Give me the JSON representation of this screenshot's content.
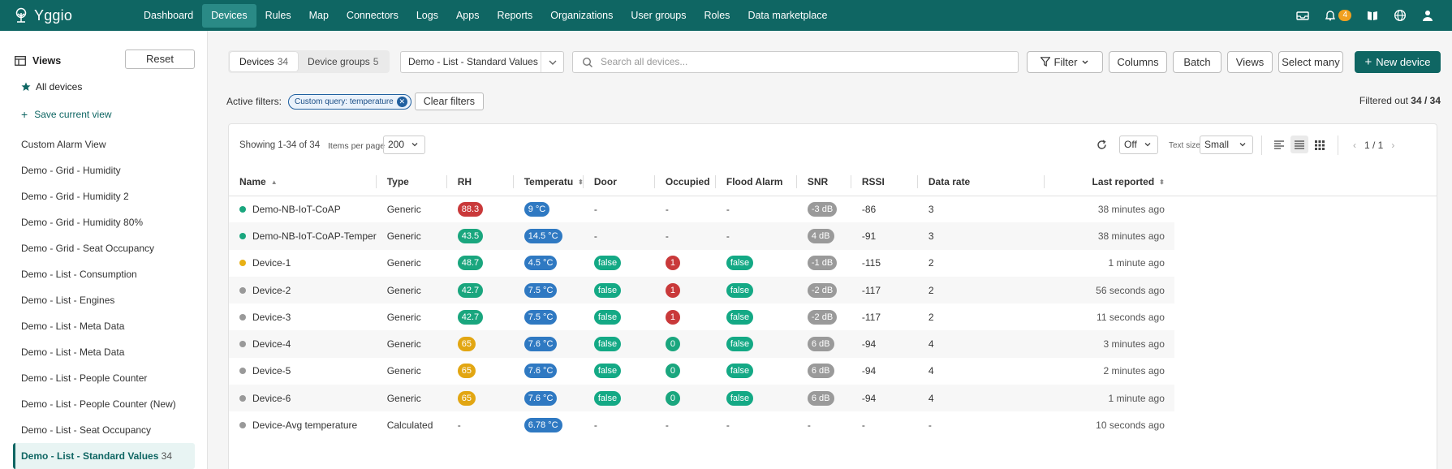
{
  "app": {
    "name": "Yggio",
    "notification_count": "4"
  },
  "nav": [
    "Dashboard",
    "Devices",
    "Rules",
    "Map",
    "Connectors",
    "Logs",
    "Apps",
    "Reports",
    "Organizations",
    "User groups",
    "Roles",
    "Data marketplace"
  ],
  "nav_active": "Devices",
  "sidebar": {
    "title": "Views",
    "reset_label": "Reset",
    "all_devices": "All devices",
    "save_view": "Save current view",
    "views": [
      {
        "label": "Custom Alarm View"
      },
      {
        "label": "Demo - Grid - Humidity"
      },
      {
        "label": "Demo - Grid - Humidity 2"
      },
      {
        "label": "Demo - Grid - Humidity 80%"
      },
      {
        "label": "Demo - Grid - Seat Occupancy"
      },
      {
        "label": "Demo - List - Consumption"
      },
      {
        "label": "Demo - List - Engines"
      },
      {
        "label": "Demo - List - Meta Data"
      },
      {
        "label": "Demo - List - Meta Data"
      },
      {
        "label": "Demo - List - People Counter"
      },
      {
        "label": "Demo - List - People Counter (New)"
      },
      {
        "label": "Demo - List - Seat Occupancy"
      },
      {
        "label": "Demo - List - Standard Values",
        "count": "34",
        "active": true
      }
    ]
  },
  "toolbar": {
    "tab_devices": "Devices",
    "tab_devices_count": "34",
    "tab_groups": "Device groups",
    "tab_groups_count": "5",
    "view_select": "Demo - List - Standard Values",
    "search_placeholder": "Search all devices...",
    "filter": "Filter",
    "columns": "Columns",
    "batch": "Batch",
    "views": "Views",
    "select_many": "Select many",
    "new_device": "New device"
  },
  "filters": {
    "label": "Active filters:",
    "chip": "Custom query: temperature",
    "clear": "Clear filters",
    "filtered_label": "Filtered out",
    "filtered_value": "34 / 34"
  },
  "table_controls": {
    "showing": "Showing 1-34 of 34",
    "items_per_page_label": "Items per page",
    "items_per_page": "200",
    "refresh": "Off",
    "text_size_label": "Text size",
    "text_size": "Small",
    "page": "1 / 1"
  },
  "columns": [
    "Name",
    "Type",
    "RH",
    "Temperatu",
    "Door",
    "Occupied",
    "Flood Alarm",
    "SNR",
    "RSSI",
    "Data rate",
    "Last reported"
  ],
  "colors": {
    "brand": "#0f6663",
    "green": "#1aa67e",
    "teal_pill": "#14a985",
    "red": "#c9393a",
    "blue": "#2f79c2",
    "yellow": "#e2a612",
    "gray": "#9a9a9a",
    "dot_gray": "#999999",
    "dot_green": "#1aa67e",
    "dot_yellow": "#e8b015"
  },
  "rows": [
    {
      "status": "green",
      "name": "Demo-NB-IoT-CoAP",
      "type": "Generic",
      "rh": "88.3",
      "rh_color": "red",
      "temp": "9 °C",
      "door": "-",
      "occupied": "-",
      "occupied_color": "",
      "flood": "-",
      "snr": "-3 dB",
      "rssi": "-86",
      "rate": "3",
      "last": "38 minutes ago"
    },
    {
      "status": "green",
      "name": "Demo-NB-IoT-CoAP-Temper",
      "type": "Generic",
      "rh": "43.5",
      "rh_color": "green",
      "temp": "14.5 °C",
      "door": "-",
      "occupied": "-",
      "occupied_color": "",
      "flood": "-",
      "snr": "4 dB",
      "rssi": "-91",
      "rate": "3",
      "last": "38 minutes ago"
    },
    {
      "status": "yellow",
      "name": "Device-1",
      "type": "Generic",
      "rh": "48.7",
      "rh_color": "green",
      "temp": "4.5 °C",
      "door": "false",
      "occupied": "1",
      "occupied_color": "red",
      "flood": "false",
      "snr": "-1 dB",
      "rssi": "-115",
      "rate": "2",
      "last": "1 minute ago"
    },
    {
      "status": "gray",
      "name": "Device-2",
      "type": "Generic",
      "rh": "42.7",
      "rh_color": "green",
      "temp": "7.5 °C",
      "door": "false",
      "occupied": "1",
      "occupied_color": "red",
      "flood": "false",
      "snr": "-2 dB",
      "rssi": "-117",
      "rate": "2",
      "last": "56 seconds ago"
    },
    {
      "status": "gray",
      "name": "Device-3",
      "type": "Generic",
      "rh": "42.7",
      "rh_color": "green",
      "temp": "7.5 °C",
      "door": "false",
      "occupied": "1",
      "occupied_color": "red",
      "flood": "false",
      "snr": "-2 dB",
      "rssi": "-117",
      "rate": "2",
      "last": "11 seconds ago"
    },
    {
      "status": "gray",
      "name": "Device-4",
      "type": "Generic",
      "rh": "65",
      "rh_color": "yellow",
      "temp": "7.6 °C",
      "door": "false",
      "occupied": "0",
      "occupied_color": "green",
      "flood": "false",
      "snr": "6 dB",
      "rssi": "-94",
      "rate": "4",
      "last": "3 minutes ago"
    },
    {
      "status": "gray",
      "name": "Device-5",
      "type": "Generic",
      "rh": "65",
      "rh_color": "yellow",
      "temp": "7.6 °C",
      "door": "false",
      "occupied": "0",
      "occupied_color": "green",
      "flood": "false",
      "snr": "6 dB",
      "rssi": "-94",
      "rate": "4",
      "last": "2 minutes ago"
    },
    {
      "status": "gray",
      "name": "Device-6",
      "type": "Generic",
      "rh": "65",
      "rh_color": "yellow",
      "temp": "7.6 °C",
      "door": "false",
      "occupied": "0",
      "occupied_color": "green",
      "flood": "false",
      "snr": "6 dB",
      "rssi": "-94",
      "rate": "4",
      "last": "1 minute ago"
    },
    {
      "status": "gray",
      "name": "Device-Avg temperature",
      "type": "Calculated",
      "rh": "-",
      "rh_color": "",
      "temp": "6.78 °C",
      "door": "-",
      "occupied": "-",
      "occupied_color": "",
      "flood": "-",
      "snr": "-",
      "rssi": "-",
      "rate": "-",
      "last": "10 seconds ago"
    }
  ]
}
